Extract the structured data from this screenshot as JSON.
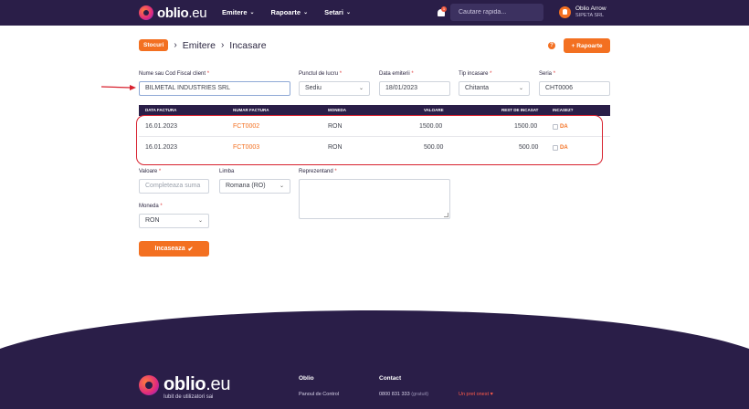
{
  "header": {
    "brand": "oblio",
    "brand_tld": ".eu",
    "nav": [
      {
        "label": "Emitere"
      },
      {
        "label": "Rapoarte"
      },
      {
        "label": "Setari"
      }
    ],
    "notification_count": "1",
    "search_placeholder": "Cautare rapida...",
    "user_name": "Oblio Arrow",
    "user_company": "SIPETA SRL"
  },
  "breadcrumb": {
    "stocuri_label": "Stocuri",
    "level1": "Emitere",
    "level2": "Incasare",
    "separator": "›"
  },
  "actions": {
    "rapoarte_label": "Rapoarte",
    "help_glyph": "?"
  },
  "form": {
    "client_label": "Nume sau Cod Fiscal client",
    "client_value": "BILMETAL INDUSTRIES SRL",
    "punct_label": "Punctul de lucru",
    "punct_value": "Sediu",
    "data_label": "Data emiterii",
    "data_value": "18/01/2023",
    "tip_label": "Tip incasare",
    "tip_value": "Chitanta",
    "seria_label": "Seria",
    "seria_value": "CHT0006",
    "valoare_label": "Valoare",
    "valoare_placeholder": "Completeaza suma",
    "limba_label": "Limba",
    "limba_value": "Romana (RO)",
    "moneda_label": "Moneda",
    "moneda_value": "RON",
    "reprezentand_label": "Reprezentand",
    "required_mark": "*",
    "submit_label": "Incaseaza"
  },
  "table": {
    "columns": [
      "DATA FACTURA",
      "NUMAR FACTURA",
      "MONEDA",
      "VALOARE",
      "REST DE INCASAT",
      "INCASEZ?"
    ],
    "rows": [
      {
        "date": "16.01.2023",
        "number": "FCT0002",
        "currency": "RON",
        "value": "1500.00",
        "rest": "1500.00",
        "check_label": "DA"
      },
      {
        "date": "16.01.2023",
        "number": "FCT0003",
        "currency": "RON",
        "value": "500.00",
        "rest": "500.00",
        "check_label": "DA"
      }
    ]
  },
  "footer": {
    "brand": "oblio",
    "brand_tld": ".eu",
    "tagline": "Iubit de utilizatori sai",
    "col1_title": "Oblio",
    "col1_link": "Panoul de Control",
    "col2_title": "Contact",
    "col2_phone": "0800 831 333",
    "col2_phone_note": "(gratuit)",
    "love_text": "Un pret onest"
  },
  "colors": {
    "accent": "#f37021",
    "navy": "#2a1e48",
    "annotation_red": "#d8222f"
  }
}
